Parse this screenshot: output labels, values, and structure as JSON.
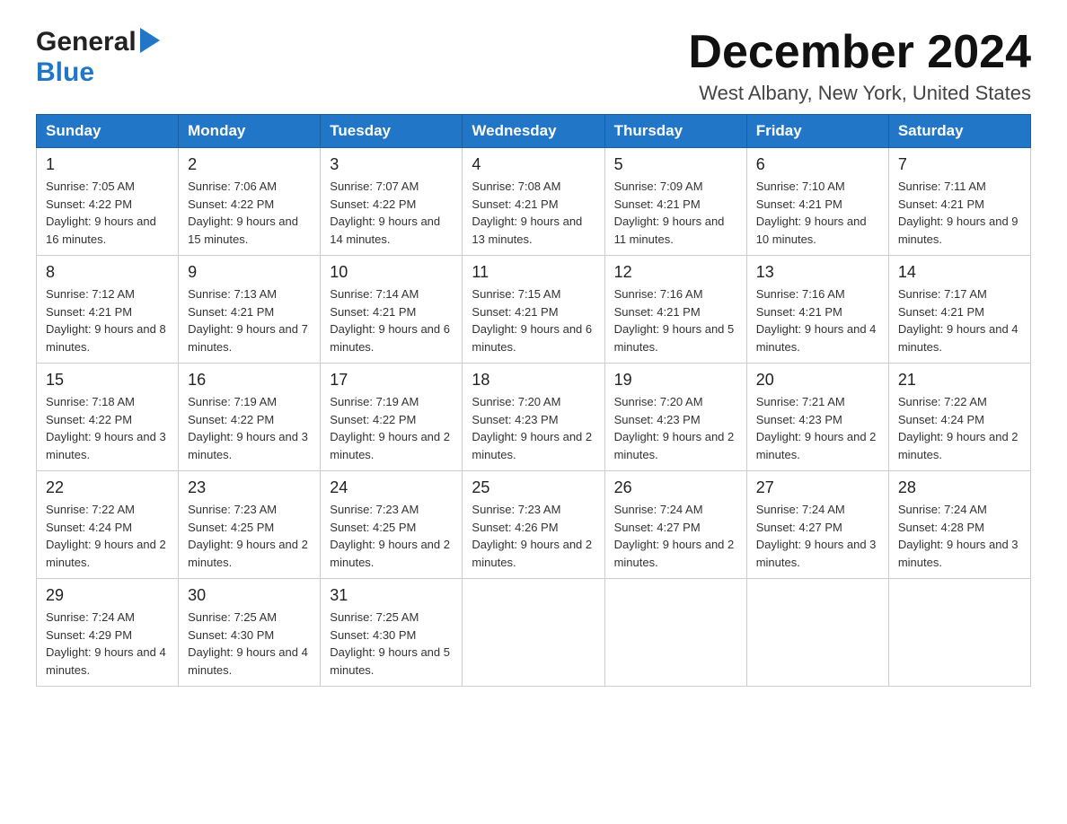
{
  "header": {
    "logo_general": "General",
    "logo_blue": "Blue",
    "month_title": "December 2024",
    "location": "West Albany, New York, United States"
  },
  "days_header": [
    "Sunday",
    "Monday",
    "Tuesday",
    "Wednesday",
    "Thursday",
    "Friday",
    "Saturday"
  ],
  "weeks": [
    [
      {
        "day": "1",
        "sunrise": "7:05 AM",
        "sunset": "4:22 PM",
        "daylight": "9 hours and 16 minutes."
      },
      {
        "day": "2",
        "sunrise": "7:06 AM",
        "sunset": "4:22 PM",
        "daylight": "9 hours and 15 minutes."
      },
      {
        "day": "3",
        "sunrise": "7:07 AM",
        "sunset": "4:22 PM",
        "daylight": "9 hours and 14 minutes."
      },
      {
        "day": "4",
        "sunrise": "7:08 AM",
        "sunset": "4:21 PM",
        "daylight": "9 hours and 13 minutes."
      },
      {
        "day": "5",
        "sunrise": "7:09 AM",
        "sunset": "4:21 PM",
        "daylight": "9 hours and 11 minutes."
      },
      {
        "day": "6",
        "sunrise": "7:10 AM",
        "sunset": "4:21 PM",
        "daylight": "9 hours and 10 minutes."
      },
      {
        "day": "7",
        "sunrise": "7:11 AM",
        "sunset": "4:21 PM",
        "daylight": "9 hours and 9 minutes."
      }
    ],
    [
      {
        "day": "8",
        "sunrise": "7:12 AM",
        "sunset": "4:21 PM",
        "daylight": "9 hours and 8 minutes."
      },
      {
        "day": "9",
        "sunrise": "7:13 AM",
        "sunset": "4:21 PM",
        "daylight": "9 hours and 7 minutes."
      },
      {
        "day": "10",
        "sunrise": "7:14 AM",
        "sunset": "4:21 PM",
        "daylight": "9 hours and 6 minutes."
      },
      {
        "day": "11",
        "sunrise": "7:15 AM",
        "sunset": "4:21 PM",
        "daylight": "9 hours and 6 minutes."
      },
      {
        "day": "12",
        "sunrise": "7:16 AM",
        "sunset": "4:21 PM",
        "daylight": "9 hours and 5 minutes."
      },
      {
        "day": "13",
        "sunrise": "7:16 AM",
        "sunset": "4:21 PM",
        "daylight": "9 hours and 4 minutes."
      },
      {
        "day": "14",
        "sunrise": "7:17 AM",
        "sunset": "4:21 PM",
        "daylight": "9 hours and 4 minutes."
      }
    ],
    [
      {
        "day": "15",
        "sunrise": "7:18 AM",
        "sunset": "4:22 PM",
        "daylight": "9 hours and 3 minutes."
      },
      {
        "day": "16",
        "sunrise": "7:19 AM",
        "sunset": "4:22 PM",
        "daylight": "9 hours and 3 minutes."
      },
      {
        "day": "17",
        "sunrise": "7:19 AM",
        "sunset": "4:22 PM",
        "daylight": "9 hours and 2 minutes."
      },
      {
        "day": "18",
        "sunrise": "7:20 AM",
        "sunset": "4:23 PM",
        "daylight": "9 hours and 2 minutes."
      },
      {
        "day": "19",
        "sunrise": "7:20 AM",
        "sunset": "4:23 PM",
        "daylight": "9 hours and 2 minutes."
      },
      {
        "day": "20",
        "sunrise": "7:21 AM",
        "sunset": "4:23 PM",
        "daylight": "9 hours and 2 minutes."
      },
      {
        "day": "21",
        "sunrise": "7:22 AM",
        "sunset": "4:24 PM",
        "daylight": "9 hours and 2 minutes."
      }
    ],
    [
      {
        "day": "22",
        "sunrise": "7:22 AM",
        "sunset": "4:24 PM",
        "daylight": "9 hours and 2 minutes."
      },
      {
        "day": "23",
        "sunrise": "7:23 AM",
        "sunset": "4:25 PM",
        "daylight": "9 hours and 2 minutes."
      },
      {
        "day": "24",
        "sunrise": "7:23 AM",
        "sunset": "4:25 PM",
        "daylight": "9 hours and 2 minutes."
      },
      {
        "day": "25",
        "sunrise": "7:23 AM",
        "sunset": "4:26 PM",
        "daylight": "9 hours and 2 minutes."
      },
      {
        "day": "26",
        "sunrise": "7:24 AM",
        "sunset": "4:27 PM",
        "daylight": "9 hours and 2 minutes."
      },
      {
        "day": "27",
        "sunrise": "7:24 AM",
        "sunset": "4:27 PM",
        "daylight": "9 hours and 3 minutes."
      },
      {
        "day": "28",
        "sunrise": "7:24 AM",
        "sunset": "4:28 PM",
        "daylight": "9 hours and 3 minutes."
      }
    ],
    [
      {
        "day": "29",
        "sunrise": "7:24 AM",
        "sunset": "4:29 PM",
        "daylight": "9 hours and 4 minutes."
      },
      {
        "day": "30",
        "sunrise": "7:25 AM",
        "sunset": "4:30 PM",
        "daylight": "9 hours and 4 minutes."
      },
      {
        "day": "31",
        "sunrise": "7:25 AM",
        "sunset": "4:30 PM",
        "daylight": "9 hours and 5 minutes."
      },
      null,
      null,
      null,
      null
    ]
  ]
}
